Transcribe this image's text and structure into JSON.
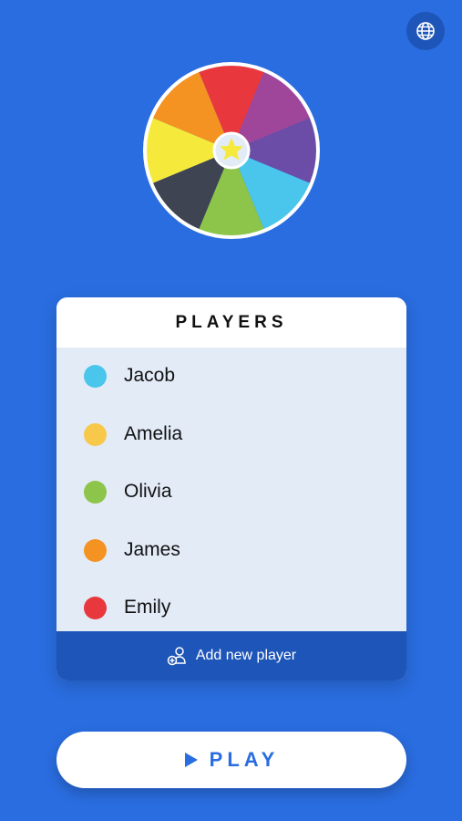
{
  "header": {
    "language_icon": "globe-icon"
  },
  "wheel": {
    "segment_colors": [
      "#e8383d",
      "#a0469a",
      "#6b4ca6",
      "#4ac5ec",
      "#8dc44a",
      "#3f4452",
      "#f5ea3c",
      "#f59322"
    ],
    "center_icon": "star-icon",
    "center_color": "#f5ea3c"
  },
  "players": {
    "title": "PLAYERS",
    "items": [
      {
        "name": "Jacob",
        "color": "#4ac5ec"
      },
      {
        "name": "Amelia",
        "color": "#f8c84a"
      },
      {
        "name": "Olivia",
        "color": "#8dc44a"
      },
      {
        "name": "James",
        "color": "#f59322"
      },
      {
        "name": "Emily",
        "color": "#e8383d"
      }
    ],
    "add_label": "Add new player",
    "add_icon": "add-user-icon"
  },
  "play": {
    "label": "PLAY",
    "icon": "play-icon"
  },
  "colors": {
    "background": "#2a6de0",
    "accent_dark": "#1e55b8",
    "list_background": "#e3ebf7"
  }
}
